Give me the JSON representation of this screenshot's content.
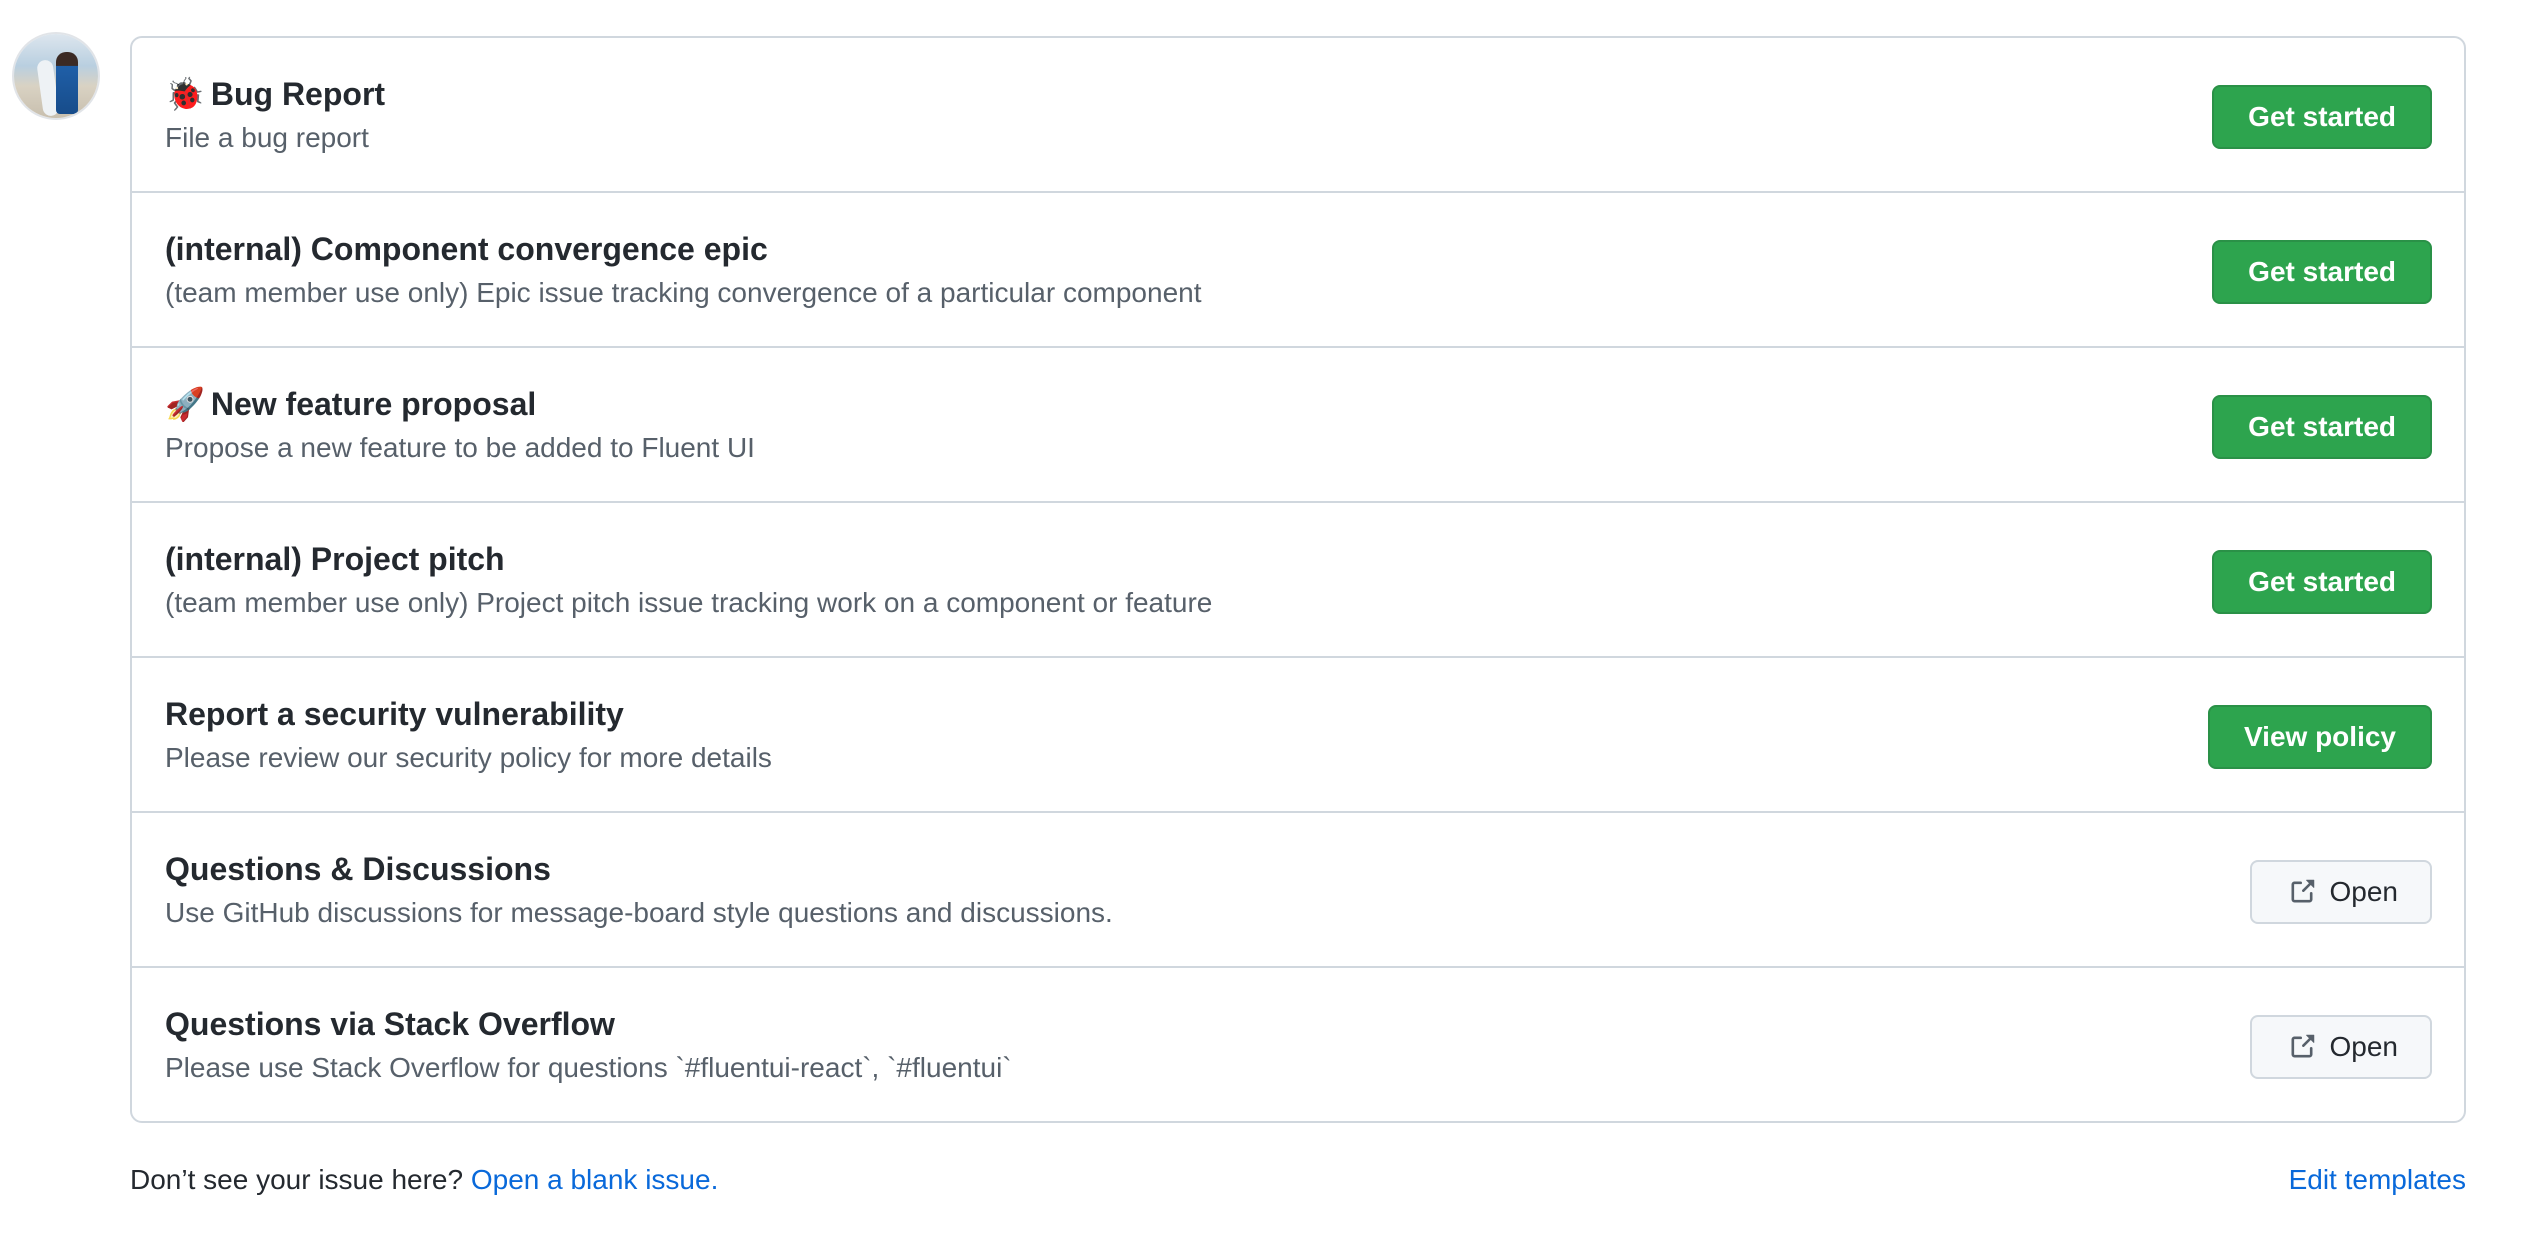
{
  "templates": [
    {
      "emoji": "🐞",
      "title": "Bug Report",
      "description": "File a bug report",
      "button": "Get started",
      "kind": "primary"
    },
    {
      "emoji": "",
      "title": "(internal) Component convergence epic",
      "description": "(team member use only) Epic issue tracking convergence of a particular component",
      "button": "Get started",
      "kind": "primary"
    },
    {
      "emoji": "🚀",
      "title": "New feature proposal",
      "description": "Propose a new feature to be added to Fluent UI",
      "button": "Get started",
      "kind": "primary"
    },
    {
      "emoji": "",
      "title": "(internal) Project pitch",
      "description": "(team member use only) Project pitch issue tracking work on a component or feature",
      "button": "Get started",
      "kind": "primary"
    },
    {
      "emoji": "",
      "title": "Report a security vulnerability",
      "description": "Please review our security policy for more details",
      "button": "View policy",
      "kind": "primary"
    },
    {
      "emoji": "",
      "title": "Questions & Discussions",
      "description": "Use GitHub discussions for message-board style questions and discussions.",
      "button": "Open",
      "kind": "external",
      "icon": "link-external-icon"
    },
    {
      "emoji": "",
      "title": "Questions via Stack Overflow",
      "description": "Please use Stack Overflow for questions `#fluentui-react`, `#fluentui`",
      "button": "Open",
      "kind": "external",
      "icon": "link-external-icon"
    }
  ],
  "footer": {
    "prompt": "Don’t see your issue here?",
    "blank_issue_link": "Open a blank issue.",
    "edit_templates_link": "Edit templates"
  },
  "colors": {
    "primary_button": "#2da44e",
    "link": "#0969da",
    "border": "#d0d7de"
  }
}
